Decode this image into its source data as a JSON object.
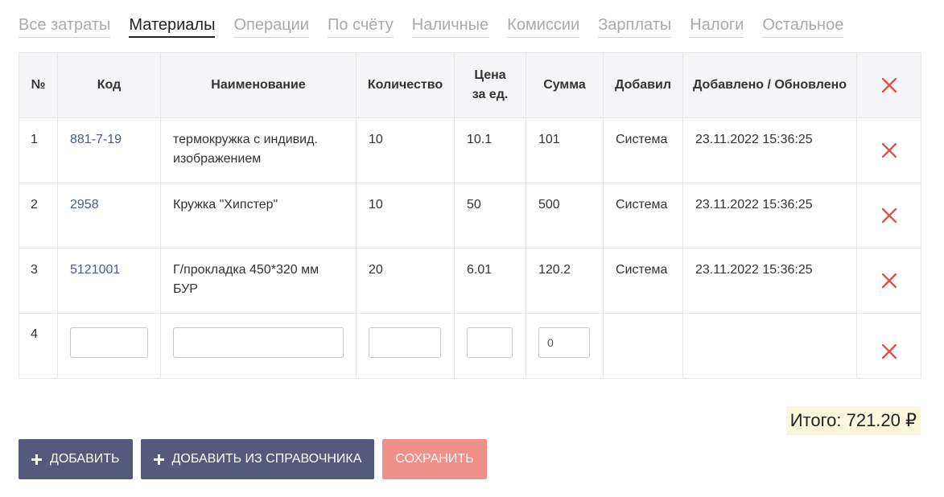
{
  "tabs": [
    {
      "label": "Все затраты",
      "active": false
    },
    {
      "label": "Материалы",
      "active": true
    },
    {
      "label": "Операции",
      "active": false
    },
    {
      "label": "По счёту",
      "active": false
    },
    {
      "label": "Наличные",
      "active": false
    },
    {
      "label": "Комиссии",
      "active": false
    },
    {
      "label": "Зарплаты",
      "active": false
    },
    {
      "label": "Налоги",
      "active": false
    },
    {
      "label": "Остальное",
      "active": false
    }
  ],
  "table": {
    "headers": {
      "num": "№",
      "code": "Код",
      "name": "Наименование",
      "qty": "Количество",
      "price_line1": "Цена",
      "price_line2": "за ед.",
      "sum": "Сумма",
      "added_by": "Добавил",
      "dates": "Добавлено / Обновлено"
    },
    "rows": [
      {
        "num": "1",
        "code": "881-7-19",
        "name": "термокружка с индивид. изображением",
        "qty": "10",
        "price": "10.1",
        "sum": "101",
        "added_by": "Система",
        "dates": "23.11.2022 15:36:25"
      },
      {
        "num": "2",
        "code": "2958",
        "name": "Кружка \"Хипстер\"",
        "qty": "10",
        "price": "50",
        "sum": "500",
        "added_by": "Система",
        "dates": "23.11.2022 15:36:25"
      },
      {
        "num": "3",
        "code": "5121001",
        "name": "Г/прокладка 450*320 мм БУР",
        "qty": "20",
        "price": "6.01",
        "sum": "120.2",
        "added_by": "Система",
        "dates": "23.11.2022 15:36:25"
      }
    ],
    "new_row": {
      "num": "4",
      "code": "",
      "name": "",
      "qty": "",
      "price": "",
      "sum": "0"
    }
  },
  "total": "Итого: 721.20 ₽",
  "buttons": {
    "add": "Добавить",
    "add_from_catalog": "Добавить из справочника",
    "save": "Сохранить"
  },
  "colors": {
    "delete_icon": "#e0534a",
    "link": "#4a5a8e",
    "button_dark": "#555a7d",
    "button_save": "#f0908a",
    "total_bg": "#fcf6dd"
  }
}
